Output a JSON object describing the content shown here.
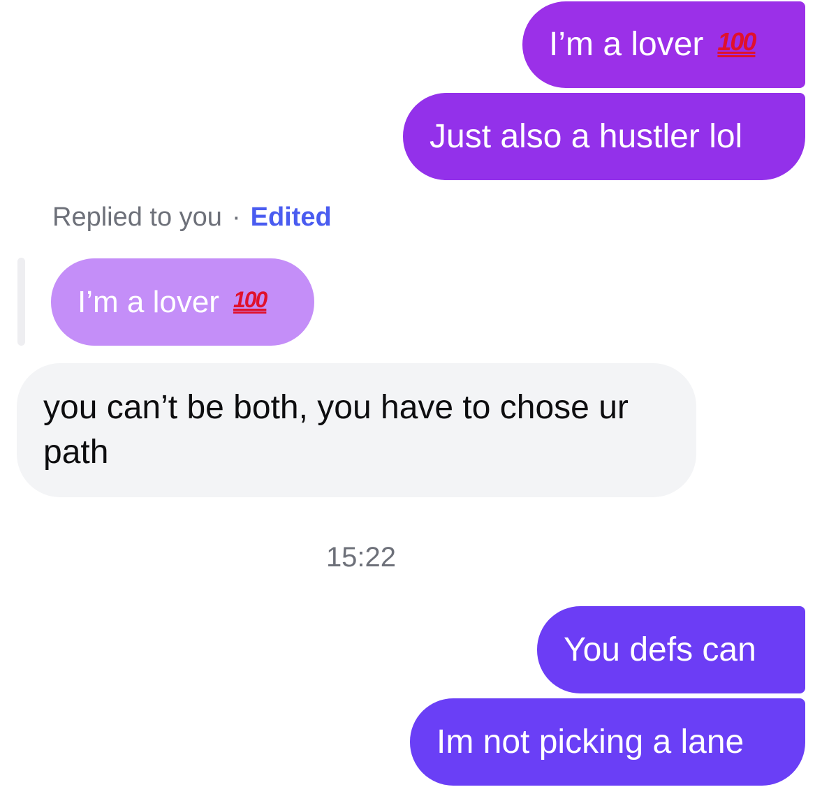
{
  "messages": {
    "out1": {
      "text": "I’m a lover",
      "emoji": "100"
    },
    "out2": {
      "text": "Just also a hustler lol"
    },
    "reply_meta": {
      "replied": "Replied to you",
      "separator": "·",
      "edited": "Edited"
    },
    "quoted": {
      "text": "I’m a lover",
      "emoji": "100"
    },
    "incoming": {
      "text": "you can’t be both, you have to chose ur path"
    },
    "timestamp": "15:22",
    "out3": {
      "text": "You defs can"
    },
    "out4": {
      "text": "Im not picking a lane"
    }
  },
  "colors": {
    "outgoing_top": "#9b30e8",
    "outgoing_bottom": "#6a3ff6",
    "quoted_bubble": "#c48ef8",
    "incoming_bubble": "#f3f4f6",
    "edited_link": "#4a5cf0",
    "hundred_emoji": "#e0112c"
  },
  "icons": {
    "hundred": "hundred-points-emoji"
  }
}
